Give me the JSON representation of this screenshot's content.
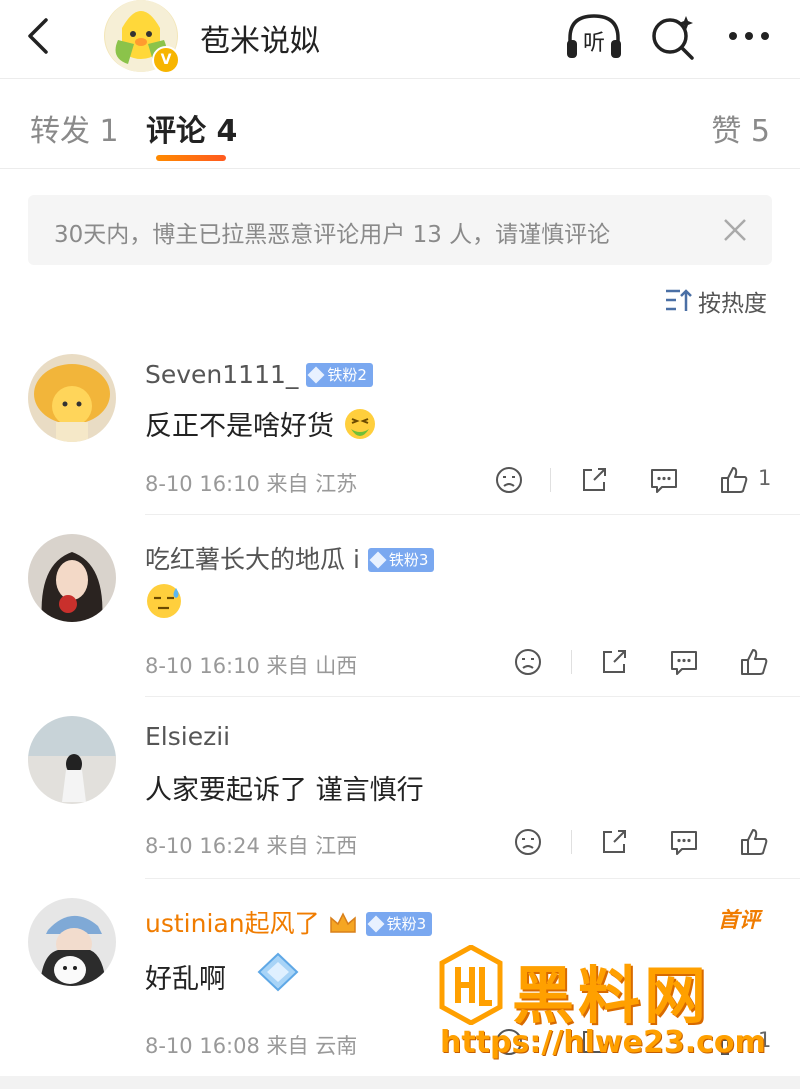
{
  "header": {
    "title": "苞米说姒",
    "listen_label": "听",
    "verified_mark": "V"
  },
  "tabs": {
    "repost": "转发 1",
    "comment": "评论 4",
    "like": "赞 5"
  },
  "notice": {
    "text": "30天内，博主已拉黑恶意评论用户 13 人，请谨慎评论"
  },
  "sort": {
    "label": "按热度"
  },
  "comments": [
    {
      "name": "Seven1111_",
      "fan_badge": "铁粉2",
      "text": "反正不是啥好货",
      "meta": "8-10 16:10  来自  江苏",
      "like_count": "1"
    },
    {
      "name": "吃红薯长大的地瓜 i",
      "fan_badge": "铁粉3",
      "text": "",
      "meta": "8-10 16:10  来自  山西",
      "like_count": ""
    },
    {
      "name": "Elsiezii",
      "fan_badge": "",
      "text": "人家要起诉了 谨言慎行",
      "meta": "8-10 16:24  来自  江西",
      "like_count": ""
    },
    {
      "name": "ustinian起风了",
      "fan_badge": "铁粉3",
      "first_tag": "首评",
      "text": "好乱啊",
      "meta": "8-10 16:08  来自  云南",
      "like_count": "1"
    }
  ],
  "watermark": {
    "brand": "黑料网",
    "url": "https://hlwe23.com"
  },
  "colors": {
    "accent": "#ff7a00",
    "fan_badge": "#7aa8f0",
    "orange_name": "#f07c00"
  }
}
